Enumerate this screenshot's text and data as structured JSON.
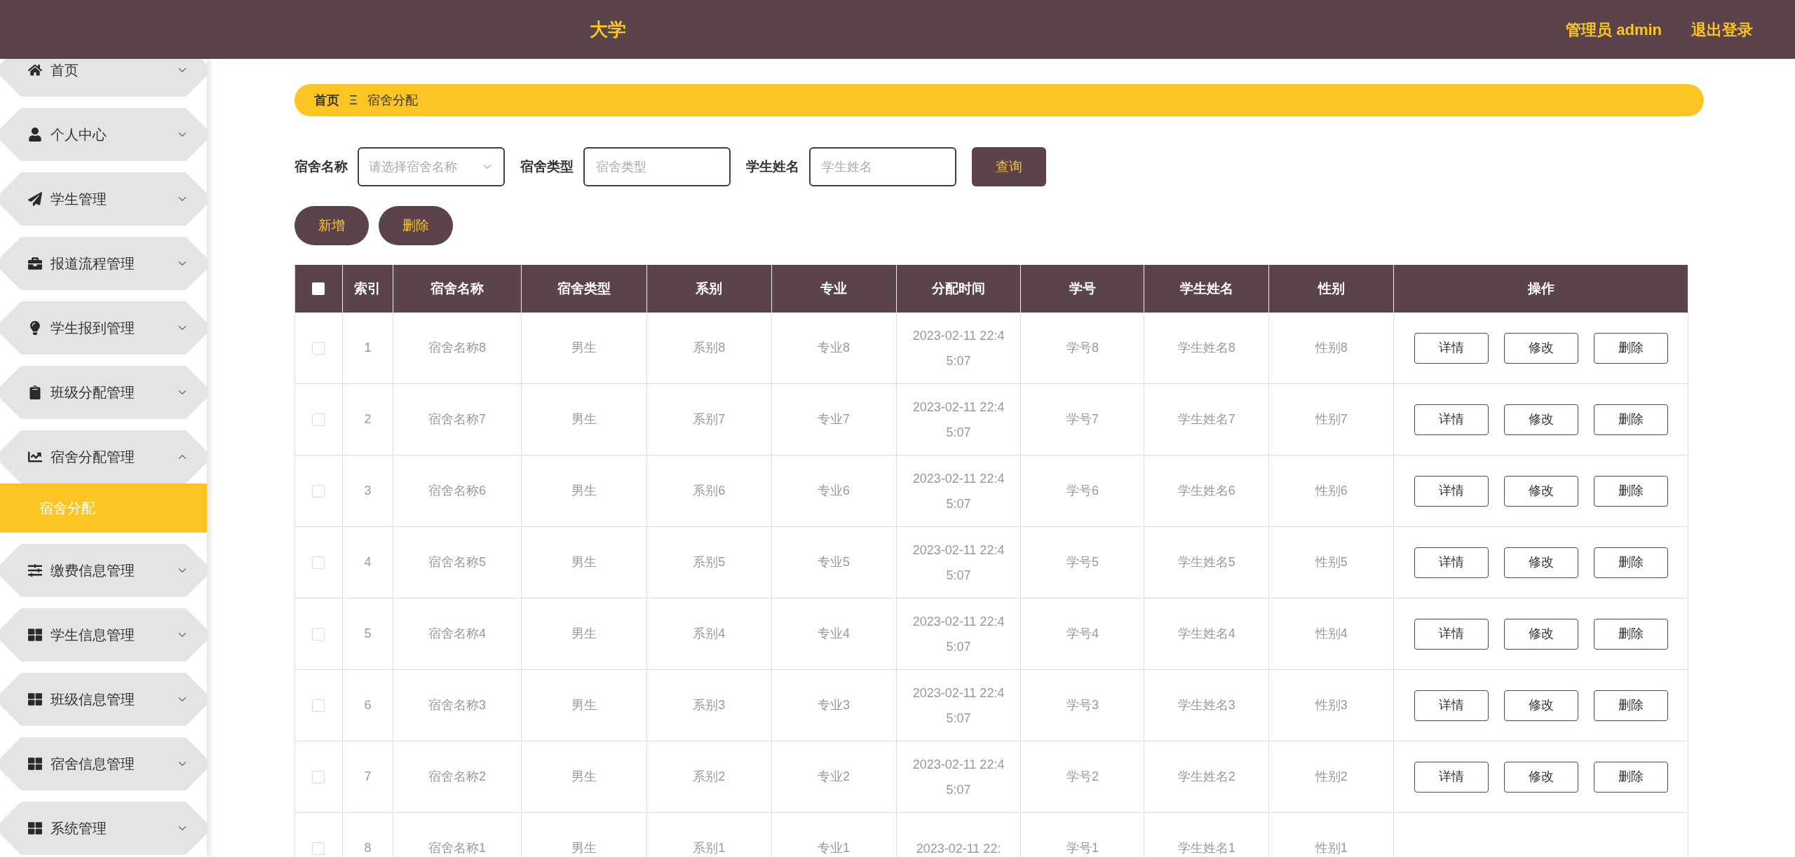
{
  "header": {
    "title": "大学",
    "user_label": "管理员 admin",
    "logout": "退出登录"
  },
  "sidebar": {
    "items": [
      {
        "label": "首页",
        "expanded": false
      },
      {
        "label": "个人中心",
        "expanded": false
      },
      {
        "label": "学生管理",
        "expanded": false
      },
      {
        "label": "报道流程管理",
        "expanded": false
      },
      {
        "label": "学生报到管理",
        "expanded": false
      },
      {
        "label": "班级分配管理",
        "expanded": false
      },
      {
        "label": "宿舍分配管理",
        "expanded": true,
        "children": [
          {
            "label": "宿舍分配",
            "selected": true
          }
        ]
      },
      {
        "label": "缴费信息管理",
        "expanded": false
      },
      {
        "label": "学生信息管理",
        "expanded": false
      },
      {
        "label": "班级信息管理",
        "expanded": false
      },
      {
        "label": "宿舍信息管理",
        "expanded": false
      },
      {
        "label": "系统管理",
        "expanded": false
      }
    ]
  },
  "breadcrumb": {
    "home": "首页",
    "separator": "Ξ",
    "current": "宿舍分配"
  },
  "search": {
    "fields": [
      {
        "label": "宿舍名称",
        "kind": "select",
        "placeholder": "请选择宿舍名称"
      },
      {
        "label": "宿舍类型",
        "kind": "input",
        "placeholder": "宿舍类型"
      },
      {
        "label": "学生姓名",
        "kind": "input",
        "placeholder": "学生姓名"
      }
    ],
    "button": "查询"
  },
  "actions": [
    "新增",
    "删除"
  ],
  "table": {
    "select_all": {
      "checked": false
    },
    "columns": [
      "索引",
      "宿舍名称",
      "宿舍类型",
      "系别",
      "专业",
      "分配时间",
      "学号",
      "学生姓名",
      "性别",
      "操作"
    ],
    "rows": [
      {
        "checked": false,
        "cells": [
          "1",
          "宿舍名称8",
          "男生",
          "系别8",
          "专业8",
          "2023-02-11 22:45:07",
          "学号8",
          "学生姓名8",
          "性别8"
        ],
        "buttons": [
          "详情",
          "修改",
          "删除"
        ]
      },
      {
        "checked": false,
        "cells": [
          "2",
          "宿舍名称7",
          "男生",
          "系别7",
          "专业7",
          "2023-02-11 22:45:07",
          "学号7",
          "学生姓名7",
          "性别7"
        ],
        "buttons": [
          "详情",
          "修改",
          "删除"
        ]
      },
      {
        "checked": false,
        "cells": [
          "3",
          "宿舍名称6",
          "男生",
          "系别6",
          "专业6",
          "2023-02-11 22:45:07",
          "学号6",
          "学生姓名6",
          "性别6"
        ],
        "buttons": [
          "详情",
          "修改",
          "删除"
        ]
      },
      {
        "checked": false,
        "cells": [
          "4",
          "宿舍名称5",
          "男生",
          "系别5",
          "专业5",
          "2023-02-11 22:45:07",
          "学号5",
          "学生姓名5",
          "性别5"
        ],
        "buttons": [
          "详情",
          "修改",
          "删除"
        ]
      },
      {
        "checked": false,
        "cells": [
          "5",
          "宿舍名称4",
          "男生",
          "系别4",
          "专业4",
          "2023-02-11 22:45:07",
          "学号4",
          "学生姓名4",
          "性别4"
        ],
        "buttons": [
          "详情",
          "修改",
          "删除"
        ]
      },
      {
        "checked": false,
        "cells": [
          "6",
          "宿舍名称3",
          "男生",
          "系别3",
          "专业3",
          "2023-02-11 22:45:07",
          "学号3",
          "学生姓名3",
          "性别3"
        ],
        "buttons": [
          "详情",
          "修改",
          "删除"
        ]
      },
      {
        "checked": false,
        "cells": [
          "7",
          "宿舍名称2",
          "男生",
          "系别2",
          "专业2",
          "2023-02-11 22:45:07",
          "学号2",
          "学生姓名2",
          "性别2"
        ],
        "buttons": [
          "详情",
          "修改",
          "删除"
        ]
      },
      {
        "checked": false,
        "cells": [
          "8",
          "宿舍名称1",
          "男生",
          "系别1",
          "专业1",
          "2023-02-11 22:",
          "学号1",
          "学生姓名1",
          "性别1"
        ]
      }
    ]
  }
}
